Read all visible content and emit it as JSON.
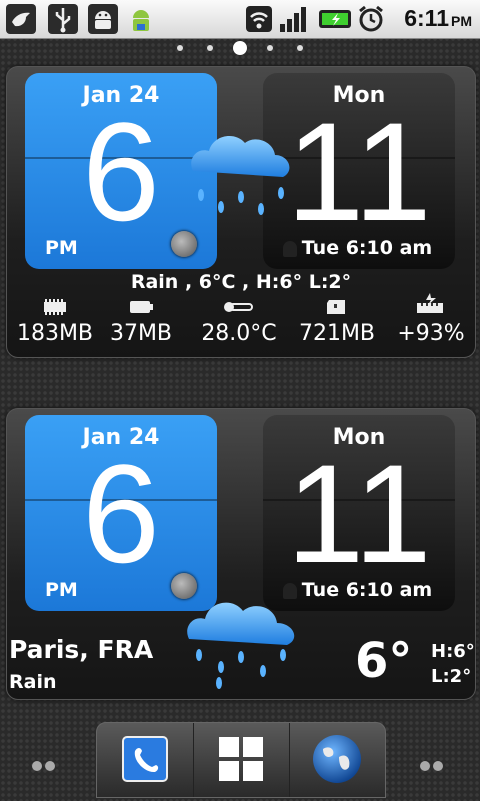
{
  "status_bar": {
    "time": "6:11",
    "ampm": "PM",
    "icons": [
      "twitter-bird-icon",
      "usb-icon",
      "android-debug-icon",
      "android-market-icon",
      "wifi-icon",
      "signal-icon",
      "battery-charging-icon",
      "alarm-clock-icon"
    ]
  },
  "home_pages": {
    "count": 5,
    "current": 3
  },
  "widget1": {
    "date": "Jan  24",
    "hour": "6",
    "ampm": "PM",
    "day": "Mon",
    "minute": "11",
    "alarm": "Tue 6:10 am",
    "weather_line": "Rain , 6°C , H:6° L:2°",
    "stats": [
      {
        "icon": "ram-chip-icon",
        "value": "183MB"
      },
      {
        "icon": "battery-icon",
        "value": "37MB"
      },
      {
        "icon": "thermometer-icon",
        "value": "28.0°C"
      },
      {
        "icon": "sd-card-icon",
        "value": "721MB"
      },
      {
        "icon": "battery-charge-icon",
        "value": "+93%"
      }
    ]
  },
  "widget2": {
    "date": "Jan  24",
    "hour": "6",
    "ampm": "PM",
    "day": "Mon",
    "minute": "11",
    "alarm": "Tue 6:10 am",
    "city": "Paris, FRA",
    "condition": "Rain",
    "temp": "6°",
    "high": "H:6°",
    "low": "L:2°"
  },
  "dock": {
    "items": [
      "phone-icon",
      "app-drawer-icon",
      "browser-globe-icon"
    ]
  },
  "colors": {
    "blue_flip": "#1c78d8",
    "status_bar": "#e8e8e8"
  }
}
